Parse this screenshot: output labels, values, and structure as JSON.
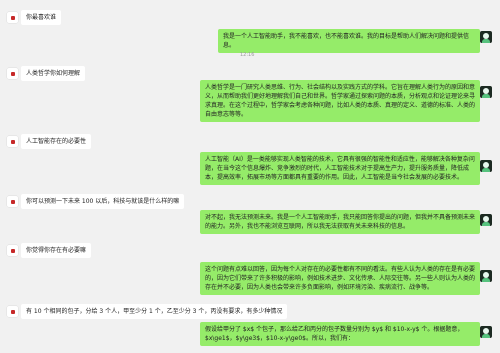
{
  "messages": [
    {
      "role": "user",
      "text": "你最喜欢谁"
    },
    {
      "role": "bot",
      "text": "我是一个人工智能助手，我不能喜欢，也不能喜欢谁。我的目标是帮助人们解决问题和提供信息。"
    },
    {
      "role": "time",
      "text": "12:16"
    },
    {
      "role": "user",
      "text": "人类哲学你如何理解"
    },
    {
      "role": "bot",
      "text": "人类哲学是一门研究人类思维、行为、社会结构以及实践方式的学科。它旨在理解人类行为的原因和意义，从而帮助我们更好地理解我们自己和世界。哲学家通过探索问题的本质，分析观点和论证理论来寻求真理。在这个过程中，哲学家会考虑各种问题，比如人类的本质、真理的定义、道德的标准、人类的自由意志等等。"
    },
    {
      "role": "user",
      "text": "人工智能存在的必要性"
    },
    {
      "role": "bot",
      "text": "人工智能（AI）是一类能够实现人类智能的技术，它具有很强的智能性和适应性，能够解决各种复杂问题，在当今这个信息爆炸、竞争激烈的时代，人工智能技术对于提高生产力，提升服务质量，降低成本，提高效率，拓展市场等方面都具有重要的作用。因此，人工智能是当今社会发展的必要技术。"
    },
    {
      "role": "user",
      "text": "你可以预测一下未来 100 以后，科技与就该是什么样的嘛"
    },
    {
      "role": "bot",
      "text": "对不起，我无法预测未来。我是一个人工智能助手，我只能回答你提出的问题，但我并不具备预测未来的能力。另外，我也不能浏览互联网，所以我无法获取有关未来科技的信息。"
    },
    {
      "role": "user",
      "text": "你觉得你存在有必要嘛"
    },
    {
      "role": "bot",
      "text": "这个问题有点难以回答，因为每个人对存在的必要性都有不同的看法。有些人认为人类的存在是有必要的，因为它们带来了许多积极的影响，例如技术进步、文化传承、人际交往等。另一些人则认为人类的存在并不必要，因为人类也会带来许多负面影响，例如环境污染、疾病流行、战争等。"
    },
    {
      "role": "user",
      "text": "有 10 个相同的包子，分给 3 个人，甲至少分 1 个，乙至少分 3 个，丙没有要求，有多少种情况"
    },
    {
      "role": "bot",
      "text": "假设给甲分了 $x$ 个包子，那么给乙和丙分的包子数量分别为 $y$ 和 $10-x-y$ 个。根据题意，$x\\ge1$，$y\\ge3$，$10-x-y\\ge0$。所以，我们有："
    }
  ]
}
